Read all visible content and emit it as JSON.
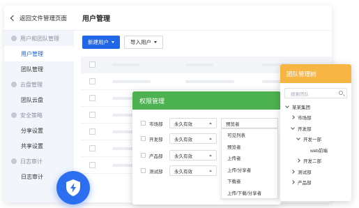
{
  "sidebar": {
    "back_label": "返回文件管理页面",
    "groups": [
      {
        "label": "用户和团队管理",
        "icon": "users-icon",
        "items": [
          {
            "label": "用户管理",
            "active": true
          },
          {
            "label": "团队管理",
            "active": false
          }
        ]
      },
      {
        "label": "云盘管理",
        "icon": "cloud-icon",
        "items": [
          {
            "label": "团队云盘",
            "active": false
          }
        ]
      },
      {
        "label": "安全策略",
        "icon": "shield-icon",
        "items": [
          {
            "label": "分享设置",
            "active": false
          },
          {
            "label": "共享设置",
            "active": false
          }
        ]
      },
      {
        "label": "日志审计",
        "icon": "log-icon",
        "items": [
          {
            "label": "日志审计",
            "active": false
          }
        ]
      }
    ]
  },
  "main": {
    "title": "用户管理",
    "new_user_label": "新建用户",
    "import_user_label": "导入用户"
  },
  "permission_panel": {
    "title": "权限管理",
    "rows": [
      {
        "dept": "市场部",
        "validity": "永久有效",
        "role": "预览者"
      },
      {
        "dept": "开发部",
        "validity": "永久有效"
      },
      {
        "dept": "产品部",
        "validity": "永久有效"
      },
      {
        "dept": "测试部",
        "validity": "永久有效"
      }
    ],
    "role_options": [
      "可见列表",
      "预览者",
      "上传者",
      "上传/分享者",
      "下载者",
      "上传/下载/分享者"
    ]
  },
  "team_tree": {
    "title": "团队管理树",
    "search_placeholder": "搜索团队",
    "nodes": [
      {
        "label": "某某集团",
        "level": 0,
        "state": "expanded"
      },
      {
        "label": "市场部",
        "level": 1,
        "state": "collapsed"
      },
      {
        "label": "开发部",
        "level": 1,
        "state": "expanded"
      },
      {
        "label": "开发一部",
        "level": 2,
        "state": "expanded"
      },
      {
        "label": "web前端",
        "level": 3,
        "state": "leaf"
      },
      {
        "label": "开发二部",
        "level": 2,
        "state": "collapsed"
      },
      {
        "label": "测试部",
        "level": 1,
        "state": "collapsed"
      },
      {
        "label": "产品部",
        "level": 1,
        "state": "collapsed"
      }
    ]
  },
  "colors": {
    "primary": "#2166e6",
    "permission_header": "#4cb14f",
    "tree_header": "#f7b643",
    "active_text": "#1a5fdc"
  },
  "badge": {
    "icon": "shield-lightning-icon"
  }
}
